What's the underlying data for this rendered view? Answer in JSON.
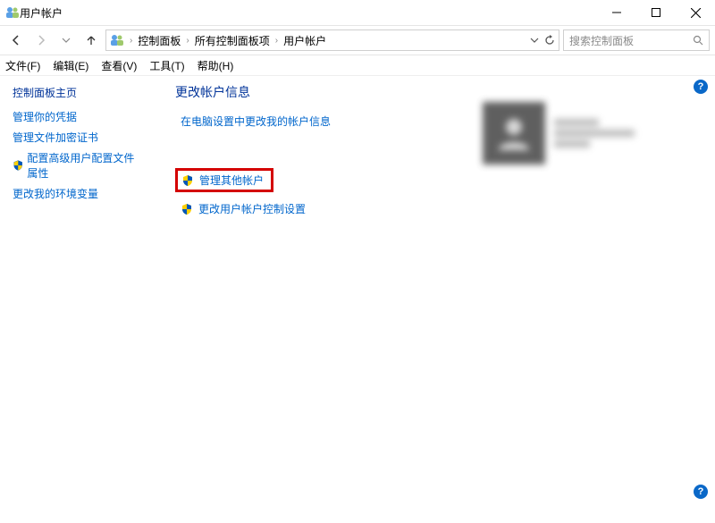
{
  "window": {
    "title": "用户帐户",
    "controls": {
      "minimize": "–",
      "maximize": "□",
      "close": "×"
    }
  },
  "nav": {
    "back_enabled": true,
    "forward_enabled": false,
    "up_enabled": true
  },
  "breadcrumb": {
    "items": [
      "控制面板",
      "所有控制面板项",
      "用户帐户"
    ]
  },
  "search": {
    "placeholder": "搜索控制面板"
  },
  "menu": {
    "items": [
      "文件(F)",
      "编辑(E)",
      "查看(V)",
      "工具(T)",
      "帮助(H)"
    ]
  },
  "sidebar": {
    "title": "控制面板主页",
    "links": [
      {
        "label": "管理你的凭据",
        "shield": false
      },
      {
        "label": "管理文件加密证书",
        "shield": false
      },
      {
        "label": "配置高级用户配置文件属性",
        "shield": true
      },
      {
        "label": "更改我的环境变量",
        "shield": false
      }
    ]
  },
  "main": {
    "heading": "更改帐户信息",
    "links": [
      {
        "label": "在电脑设置中更改我的帐户信息",
        "shield": false,
        "highlight": false
      },
      {
        "label": "管理其他帐户",
        "shield": true,
        "highlight": true
      },
      {
        "label": "更改用户帐户控制设置",
        "shield": true,
        "highlight": false
      }
    ]
  },
  "help_icon_text": "?"
}
